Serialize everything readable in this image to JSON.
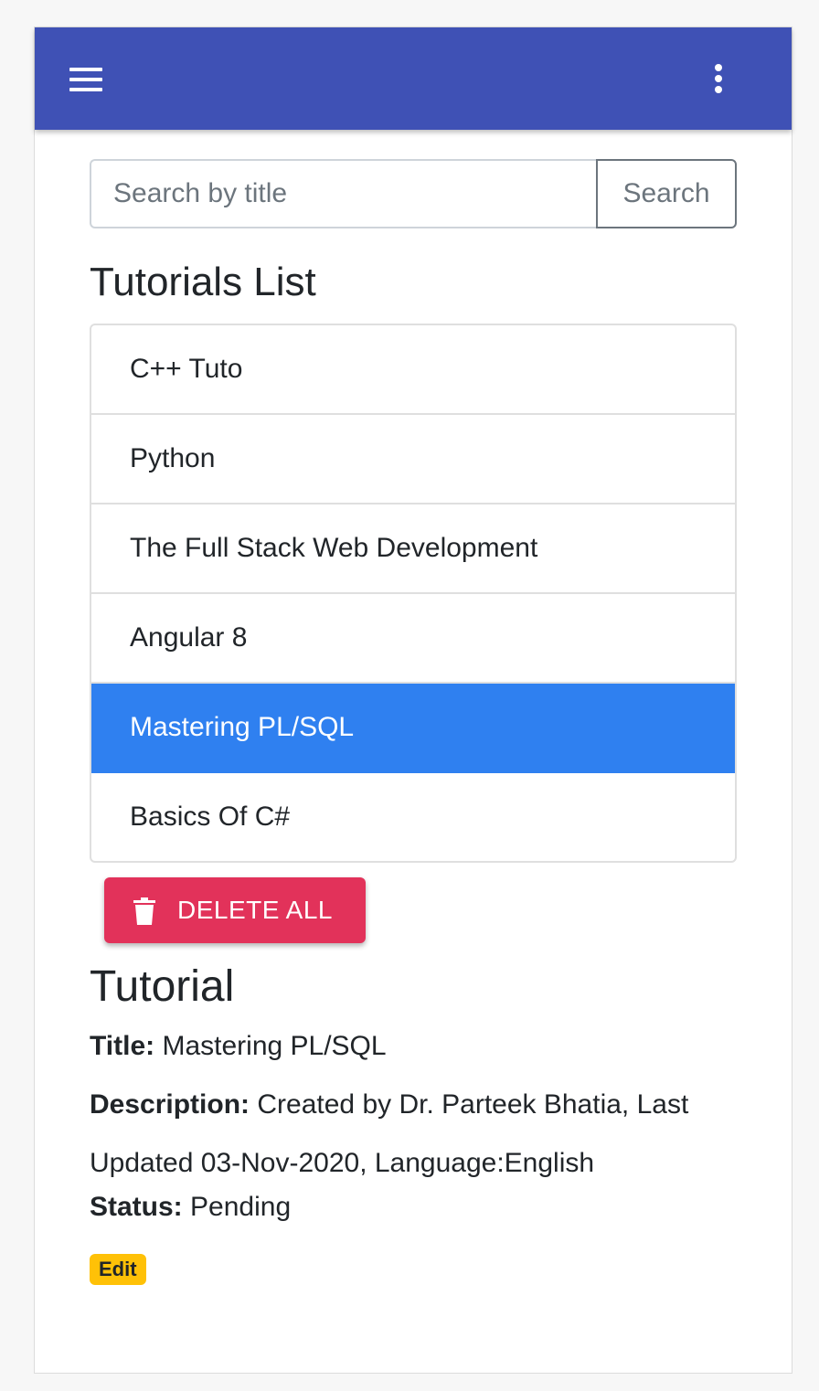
{
  "header": {
    "menu_icon": "hamburger-menu-icon",
    "more_icon": "more-vertical-icon",
    "color": "#3f51b5"
  },
  "search": {
    "placeholder": "Search by title",
    "value": "",
    "button_label": "Search"
  },
  "list": {
    "title": "Tutorials List",
    "items": [
      {
        "label": "C++ Tuto",
        "active": false
      },
      {
        "label": "Python",
        "active": false
      },
      {
        "label": "The Full Stack Web Development",
        "active": false
      },
      {
        "label": "Angular 8",
        "active": false
      },
      {
        "label": "Mastering PL/SQL",
        "active": true
      },
      {
        "label": "Basics Of C#",
        "active": false
      }
    ],
    "active_color": "#2f80f0"
  },
  "delete_all": {
    "label": "DELETE ALL",
    "icon": "trash-icon",
    "color": "#e2325a"
  },
  "tutorial": {
    "heading": "Tutorial",
    "title_label": "Title:",
    "title_value": "Mastering PL/SQL",
    "description_label": "Description:",
    "description_line1": "Created by Dr. Parteek Bhatia, Last",
    "description_line2": "Updated 03-Nov-2020, Language:English",
    "status_label": "Status:",
    "status_value": "Pending",
    "edit_label": "Edit",
    "edit_color": "#ffc107"
  }
}
